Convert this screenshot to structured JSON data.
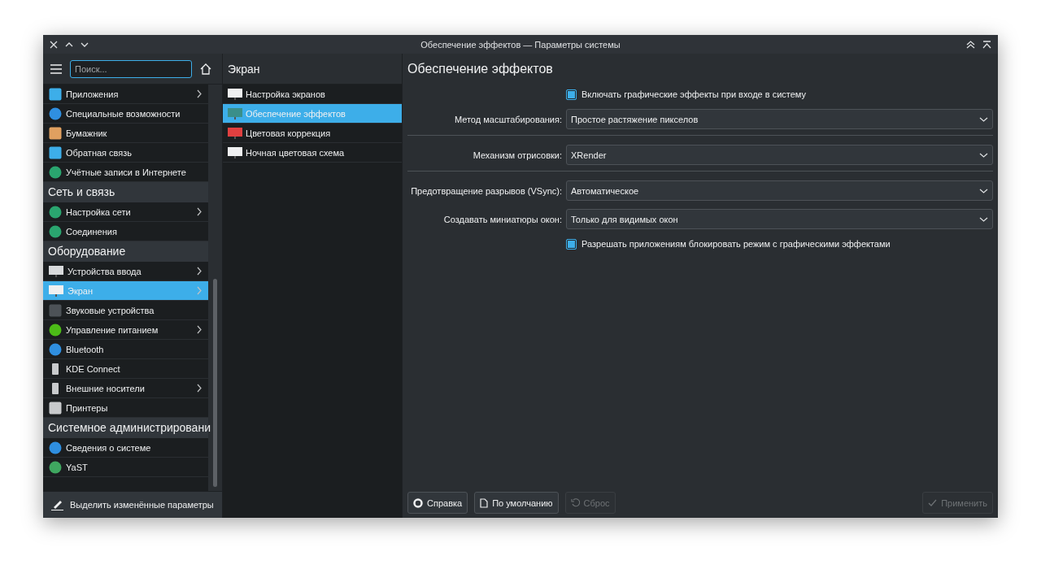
{
  "window": {
    "title": "Обеспечение эффектов — Параметры системы"
  },
  "sidebar": {
    "search": {
      "placeholder": "Поиск..."
    },
    "items": [
      {
        "kind": "item",
        "label": "Приложения",
        "has_children": true,
        "selected": false
      },
      {
        "kind": "item",
        "label": "Специальные возможности",
        "has_children": false,
        "selected": false
      },
      {
        "kind": "item",
        "label": "Бумажник",
        "has_children": false,
        "selected": false
      },
      {
        "kind": "item",
        "label": "Обратная связь",
        "has_children": false,
        "selected": false
      },
      {
        "kind": "item",
        "label": "Учётные записи в Интернете",
        "has_children": false,
        "selected": false
      },
      {
        "kind": "section",
        "label": "Сеть и связь"
      },
      {
        "kind": "item",
        "label": "Настройка сети",
        "has_children": true,
        "selected": false
      },
      {
        "kind": "item",
        "label": "Соединения",
        "has_children": false,
        "selected": false
      },
      {
        "kind": "section",
        "label": "Оборудование"
      },
      {
        "kind": "item",
        "label": "Устройства ввода",
        "has_children": true,
        "selected": false
      },
      {
        "kind": "item",
        "label": "Экран",
        "has_children": true,
        "selected": true
      },
      {
        "kind": "item",
        "label": "Звуковые устройства",
        "has_children": false,
        "selected": false
      },
      {
        "kind": "item",
        "label": "Управление питанием",
        "has_children": true,
        "selected": false
      },
      {
        "kind": "item",
        "label": "Bluetooth",
        "has_children": false,
        "selected": false
      },
      {
        "kind": "item",
        "label": "KDE Connect",
        "has_children": false,
        "selected": false
      },
      {
        "kind": "item",
        "label": "Внешние носители",
        "has_children": true,
        "selected": false
      },
      {
        "kind": "item",
        "label": "Принтеры",
        "has_children": false,
        "selected": false
      },
      {
        "kind": "section",
        "label": "Системное администрировани"
      },
      {
        "kind": "item",
        "label": "Сведения о системе",
        "has_children": false,
        "selected": false
      },
      {
        "kind": "item",
        "label": "YaST",
        "has_children": false,
        "selected": false
      }
    ],
    "footer": "Выделить изменённые параметры"
  },
  "subpanel": {
    "title": "Экран",
    "items": [
      {
        "label": "Настройка экранов",
        "selected": false
      },
      {
        "label": "Обеспечение эффектов",
        "selected": true
      },
      {
        "label": "Цветовая коррекция",
        "selected": false
      },
      {
        "label": "Ночная цветовая схема",
        "selected": false
      }
    ]
  },
  "page": {
    "title": "Обеспечение эффектов",
    "rows": [
      {
        "kind": "checkbox",
        "label": "Включать графические эффекты при входе в систему",
        "checked": true
      },
      {
        "kind": "combo",
        "label": "Метод масштабирования:",
        "value": "Простое растяжение пикселов",
        "separator": true
      },
      {
        "kind": "combo",
        "label": "Механизм отрисовки:",
        "value": "XRender",
        "separator": true
      },
      {
        "kind": "combo",
        "label": "Предотвращение разрывов (VSync):",
        "value": "Автоматическое",
        "separator": false
      },
      {
        "kind": "combo",
        "label": "Создавать миниатюры окон:",
        "value": "Только для видимых окон",
        "separator": false
      },
      {
        "kind": "checkbox",
        "label": "Разрешать приложениям блокировать режим с графическими эффектами",
        "checked": true
      }
    ]
  },
  "buttons": [
    {
      "kind": "help",
      "label": "Справка",
      "disabled": false
    },
    {
      "kind": "defaults",
      "label": "По умолчанию",
      "disabled": false
    },
    {
      "kind": "reset",
      "label": "Сброс",
      "disabled": true
    },
    {
      "kind": "apply",
      "label": "Применить",
      "disabled": true
    }
  ]
}
